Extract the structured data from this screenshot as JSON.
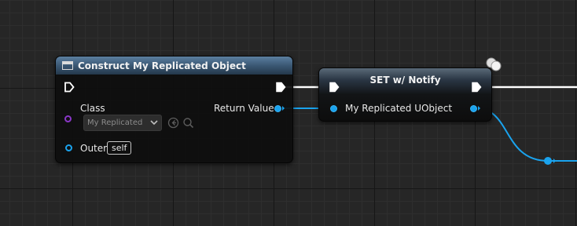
{
  "construct_node": {
    "title": "Construct My Replicated Object",
    "class_label": "Class",
    "class_value": "My Replicated Object",
    "return_label": "Return Value",
    "outer_label": "Outer",
    "outer_value": "self"
  },
  "set_node": {
    "title": "SET w/ Notify",
    "input_label": "My Replicated UObject"
  },
  "icons": {
    "function_icon": "function-icon",
    "exec_pin": "exec-pin-icon",
    "browse": "browse-arrow-icon",
    "search": "magnifier-icon",
    "replicated": "replication-indicator-icon"
  },
  "colors": {
    "object_pin": "#1aa3ee",
    "class_pin": "#8a37c8",
    "exec_wire": "#ffffff",
    "header_function": "#3b5874"
  }
}
